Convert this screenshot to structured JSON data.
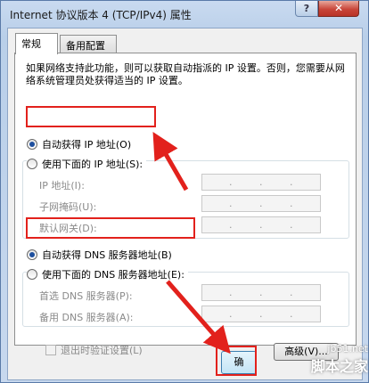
{
  "window": {
    "title": "Internet 协议版本 4 (TCP/IPv4) 属性",
    "help_label": "?",
    "close_label": "✕"
  },
  "tabs": [
    {
      "label": "常规",
      "active": true
    },
    {
      "label": "备用配置",
      "active": false
    }
  ],
  "description": "如果网络支持此功能，则可以获取自动指派的 IP 设置。否则，您需要从网络系统管理员处获得适当的 IP 设置。",
  "ip_section": {
    "auto_label": "自动获得 IP 地址(O)",
    "auto_selected": true,
    "manual_label": "使用下面的 IP 地址(S):",
    "manual_selected": false,
    "fields": [
      {
        "label": "IP 地址(I):",
        "value": ". . ."
      },
      {
        "label": "子网掩码(U):",
        "value": ". . ."
      },
      {
        "label": "默认网关(D):",
        "value": ". . ."
      }
    ]
  },
  "dns_section": {
    "auto_label": "自动获得 DNS 服务器地址(B)",
    "auto_selected": true,
    "manual_label": "使用下面的 DNS 服务器地址(E):",
    "manual_selected": false,
    "fields": [
      {
        "label": "首选 DNS 服务器(P):",
        "value": ". . ."
      },
      {
        "label": "备用 DNS 服务器(A):",
        "value": ". . ."
      }
    ]
  },
  "validate_checkbox": {
    "label": "退出时验证设置(L)",
    "checked": false
  },
  "advanced_button": "高级(V)...",
  "ok_button": "确",
  "highlight_color": "#e2211c",
  "watermark": {
    "top": "jb51.net",
    "bottom": "脚本之家"
  }
}
